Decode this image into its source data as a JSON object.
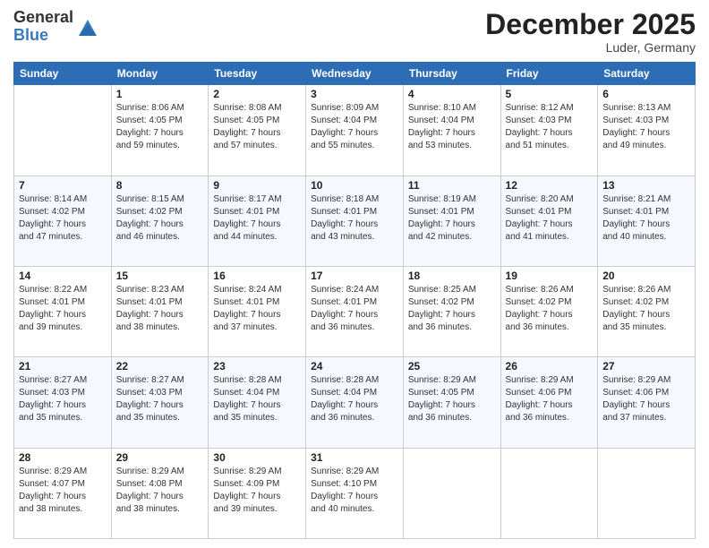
{
  "header": {
    "logo_line1": "General",
    "logo_line2": "Blue",
    "month": "December 2025",
    "location": "Luder, Germany"
  },
  "weekdays": [
    "Sunday",
    "Monday",
    "Tuesday",
    "Wednesday",
    "Thursday",
    "Friday",
    "Saturday"
  ],
  "weeks": [
    [
      {
        "day": "",
        "info": ""
      },
      {
        "day": "1",
        "info": "Sunrise: 8:06 AM\nSunset: 4:05 PM\nDaylight: 7 hours\nand 59 minutes."
      },
      {
        "day": "2",
        "info": "Sunrise: 8:08 AM\nSunset: 4:05 PM\nDaylight: 7 hours\nand 57 minutes."
      },
      {
        "day": "3",
        "info": "Sunrise: 8:09 AM\nSunset: 4:04 PM\nDaylight: 7 hours\nand 55 minutes."
      },
      {
        "day": "4",
        "info": "Sunrise: 8:10 AM\nSunset: 4:04 PM\nDaylight: 7 hours\nand 53 minutes."
      },
      {
        "day": "5",
        "info": "Sunrise: 8:12 AM\nSunset: 4:03 PM\nDaylight: 7 hours\nand 51 minutes."
      },
      {
        "day": "6",
        "info": "Sunrise: 8:13 AM\nSunset: 4:03 PM\nDaylight: 7 hours\nand 49 minutes."
      }
    ],
    [
      {
        "day": "7",
        "info": "Sunrise: 8:14 AM\nSunset: 4:02 PM\nDaylight: 7 hours\nand 47 minutes."
      },
      {
        "day": "8",
        "info": "Sunrise: 8:15 AM\nSunset: 4:02 PM\nDaylight: 7 hours\nand 46 minutes."
      },
      {
        "day": "9",
        "info": "Sunrise: 8:17 AM\nSunset: 4:01 PM\nDaylight: 7 hours\nand 44 minutes."
      },
      {
        "day": "10",
        "info": "Sunrise: 8:18 AM\nSunset: 4:01 PM\nDaylight: 7 hours\nand 43 minutes."
      },
      {
        "day": "11",
        "info": "Sunrise: 8:19 AM\nSunset: 4:01 PM\nDaylight: 7 hours\nand 42 minutes."
      },
      {
        "day": "12",
        "info": "Sunrise: 8:20 AM\nSunset: 4:01 PM\nDaylight: 7 hours\nand 41 minutes."
      },
      {
        "day": "13",
        "info": "Sunrise: 8:21 AM\nSunset: 4:01 PM\nDaylight: 7 hours\nand 40 minutes."
      }
    ],
    [
      {
        "day": "14",
        "info": "Sunrise: 8:22 AM\nSunset: 4:01 PM\nDaylight: 7 hours\nand 39 minutes."
      },
      {
        "day": "15",
        "info": "Sunrise: 8:23 AM\nSunset: 4:01 PM\nDaylight: 7 hours\nand 38 minutes."
      },
      {
        "day": "16",
        "info": "Sunrise: 8:24 AM\nSunset: 4:01 PM\nDaylight: 7 hours\nand 37 minutes."
      },
      {
        "day": "17",
        "info": "Sunrise: 8:24 AM\nSunset: 4:01 PM\nDaylight: 7 hours\nand 36 minutes."
      },
      {
        "day": "18",
        "info": "Sunrise: 8:25 AM\nSunset: 4:02 PM\nDaylight: 7 hours\nand 36 minutes."
      },
      {
        "day": "19",
        "info": "Sunrise: 8:26 AM\nSunset: 4:02 PM\nDaylight: 7 hours\nand 36 minutes."
      },
      {
        "day": "20",
        "info": "Sunrise: 8:26 AM\nSunset: 4:02 PM\nDaylight: 7 hours\nand 35 minutes."
      }
    ],
    [
      {
        "day": "21",
        "info": "Sunrise: 8:27 AM\nSunset: 4:03 PM\nDaylight: 7 hours\nand 35 minutes."
      },
      {
        "day": "22",
        "info": "Sunrise: 8:27 AM\nSunset: 4:03 PM\nDaylight: 7 hours\nand 35 minutes."
      },
      {
        "day": "23",
        "info": "Sunrise: 8:28 AM\nSunset: 4:04 PM\nDaylight: 7 hours\nand 35 minutes."
      },
      {
        "day": "24",
        "info": "Sunrise: 8:28 AM\nSunset: 4:04 PM\nDaylight: 7 hours\nand 36 minutes."
      },
      {
        "day": "25",
        "info": "Sunrise: 8:29 AM\nSunset: 4:05 PM\nDaylight: 7 hours\nand 36 minutes."
      },
      {
        "day": "26",
        "info": "Sunrise: 8:29 AM\nSunset: 4:06 PM\nDaylight: 7 hours\nand 36 minutes."
      },
      {
        "day": "27",
        "info": "Sunrise: 8:29 AM\nSunset: 4:06 PM\nDaylight: 7 hours\nand 37 minutes."
      }
    ],
    [
      {
        "day": "28",
        "info": "Sunrise: 8:29 AM\nSunset: 4:07 PM\nDaylight: 7 hours\nand 38 minutes."
      },
      {
        "day": "29",
        "info": "Sunrise: 8:29 AM\nSunset: 4:08 PM\nDaylight: 7 hours\nand 38 minutes."
      },
      {
        "day": "30",
        "info": "Sunrise: 8:29 AM\nSunset: 4:09 PM\nDaylight: 7 hours\nand 39 minutes."
      },
      {
        "day": "31",
        "info": "Sunrise: 8:29 AM\nSunset: 4:10 PM\nDaylight: 7 hours\nand 40 minutes."
      },
      {
        "day": "",
        "info": ""
      },
      {
        "day": "",
        "info": ""
      },
      {
        "day": "",
        "info": ""
      }
    ]
  ]
}
